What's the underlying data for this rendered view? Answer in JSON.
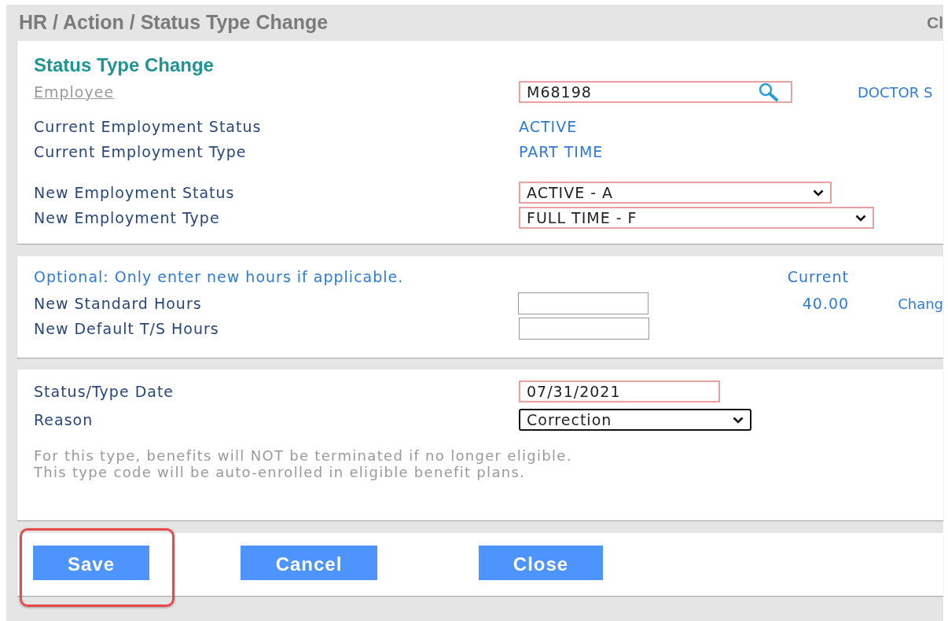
{
  "breadcrumb": "HR / Action / Status Type Change",
  "header_right": "Cl",
  "section1": {
    "title": "Status Type Change",
    "rows": [
      {
        "kind": "lookup",
        "label": "Employee",
        "value": "M68198",
        "required": true,
        "extra": "DOCTOR S"
      },
      {
        "kind": "text",
        "label": "Current Employment Status",
        "value": "ACTIVE"
      },
      {
        "kind": "text",
        "label": "Current Employment Type",
        "value": "PART TIME"
      },
      {
        "kind": "select",
        "label": "New Employment Status",
        "value": "ACTIVE - A",
        "required": true,
        "focused": false
      },
      {
        "kind": "select",
        "label": "New Employment Type",
        "value": "FULL TIME - F",
        "required": true,
        "focused": false
      }
    ]
  },
  "section2": {
    "note": "Optional: Only enter new hours if applicable.",
    "current_heading": "Current",
    "rows": [
      {
        "label": "New Standard Hours",
        "value": "",
        "current": "40.00",
        "extra": "Chang"
      },
      {
        "label": "New Default T/S Hours",
        "value": ""
      }
    ]
  },
  "section3": {
    "rows": [
      {
        "kind": "input",
        "label": "Status/Type Date",
        "value": "07/31/2021",
        "required": true
      },
      {
        "kind": "select",
        "label": "Reason",
        "value": "Correction",
        "required": false,
        "focused": true
      }
    ],
    "notes": [
      "For this type, benefits will NOT be terminated if no longer eligible.",
      "This type code will be auto-enrolled in eligible benefit plans."
    ]
  },
  "buttons": [
    {
      "label": "Save",
      "highlighted": true
    },
    {
      "label": "Cancel",
      "highlighted": false
    },
    {
      "label": "Close",
      "highlighted": false
    }
  ]
}
